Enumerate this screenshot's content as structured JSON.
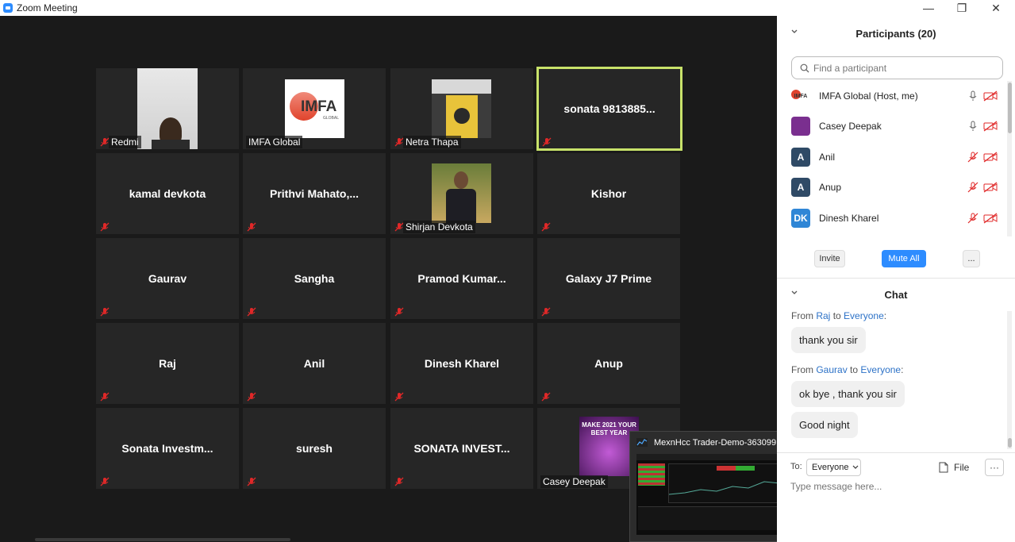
{
  "window": {
    "title": "Zoom Meeting",
    "minimize": "—",
    "restore": "❐",
    "close": "✕"
  },
  "tiles": [
    {
      "name": "",
      "label": "Redmi"
    },
    {
      "name": "",
      "label": "IMFA Global",
      "logo_text": "IMFA",
      "logo_sub": "GLOBAL"
    },
    {
      "name": "",
      "label": "Netra Thapa"
    },
    {
      "name": "sonata 9813885...",
      "label": ""
    },
    {
      "name": "kamal devkota",
      "label": ""
    },
    {
      "name": "Prithvi  Mahato,...",
      "label": ""
    },
    {
      "name": "",
      "label": "Shirjan Devkota"
    },
    {
      "name": "Kishor",
      "label": ""
    },
    {
      "name": "Gaurav",
      "label": ""
    },
    {
      "name": "Sangha",
      "label": ""
    },
    {
      "name": "Pramod  Kumar...",
      "label": ""
    },
    {
      "name": "Galaxy J7 Prime",
      "label": ""
    },
    {
      "name": "Raj",
      "label": ""
    },
    {
      "name": "Anil",
      "label": ""
    },
    {
      "name": "Dinesh Kharel",
      "label": ""
    },
    {
      "name": "Anup",
      "label": ""
    },
    {
      "name": "Sonata  Investm...",
      "label": ""
    },
    {
      "name": "suresh",
      "label": ""
    },
    {
      "name": "SONATA  INVEST...",
      "label": ""
    },
    {
      "name": "",
      "label": "Casey Deepak",
      "poster_text": "MAKE 2021 YOUR BEST YEAR"
    }
  ],
  "popup": {
    "title": "MexnHcc Trader-Demo-363099"
  },
  "participants": {
    "header": "Participants (20)",
    "search_placeholder": "Find a participant",
    "list": [
      {
        "name": "IMFA Global (Host, me)",
        "avatar": "IMFA",
        "color": "#ffffff",
        "muted": false
      },
      {
        "name": "Casey Deepak",
        "avatar": "",
        "color": "#7a2f8f",
        "muted": false
      },
      {
        "name": "Anil",
        "avatar": "A",
        "color": "#2f4a66",
        "muted": true
      },
      {
        "name": "Anup",
        "avatar": "A",
        "color": "#2f4a66",
        "muted": true
      },
      {
        "name": "Dinesh Kharel",
        "avatar": "DK",
        "color": "#2f86d6",
        "muted": true
      }
    ],
    "invite_label": "Invite",
    "mute_all_label": "Mute All",
    "more_label": "..."
  },
  "chat": {
    "header": "Chat",
    "messages": [
      {
        "from_prefix": "From ",
        "from": "Raj",
        "to_prefix": " to ",
        "to": "Everyone",
        "suffix": ":",
        "texts": [
          "thank you sir"
        ]
      },
      {
        "from_prefix": "From ",
        "from": "Gaurav",
        "to_prefix": " to ",
        "to": "Everyone",
        "suffix": ":",
        "texts": [
          "ok bye , thank you sir",
          "Good night"
        ]
      }
    ],
    "to_label": "To:",
    "to_value": "Everyone",
    "file_label": "File",
    "more_label": "···",
    "input_placeholder": "Type message here..."
  },
  "colors": {
    "accent": "#2d8cff",
    "active_speaker": "#c8e26a",
    "muted_red": "#e02828"
  }
}
